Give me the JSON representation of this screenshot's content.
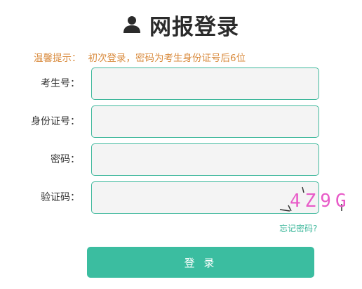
{
  "header": {
    "title": "网报登录",
    "icon": "user-icon"
  },
  "tip": {
    "label": "温馨提示：",
    "text": "初次登录，密码为考生身份证号后6位"
  },
  "form": {
    "fields": [
      {
        "label": "考生号：",
        "value": "",
        "placeholder": ""
      },
      {
        "label": "身份证号：",
        "value": "",
        "placeholder": ""
      },
      {
        "label": "密码：",
        "value": "",
        "placeholder": ""
      },
      {
        "label": "验证码：",
        "value": "",
        "placeholder": ""
      }
    ],
    "captcha_text": "4Z9G"
  },
  "forgot_password": "忘记密码?",
  "login_button": "登 录",
  "colors": {
    "accent": "#3bbda0",
    "tip": "#d98a3c",
    "title": "#2b2b2b",
    "captcha": "#e85bc8"
  }
}
